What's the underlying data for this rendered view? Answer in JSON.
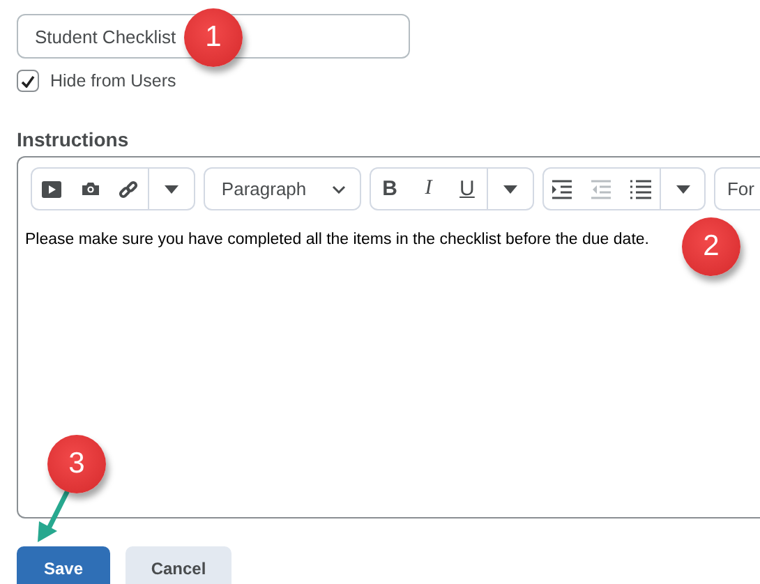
{
  "name_field": {
    "value": "Student Checklist"
  },
  "hide_from_users": {
    "label": "Hide from Users",
    "checked": true
  },
  "instructions": {
    "label": "Instructions",
    "toolbar": {
      "format_select": "Paragraph",
      "style_buttons": [
        "B",
        "I",
        "U"
      ],
      "list_buttons": [
        {
          "kind": "indent",
          "disabled": false
        },
        {
          "kind": "outdent",
          "disabled": true
        },
        {
          "kind": "bullets",
          "disabled": false
        }
      ],
      "font_button": "For"
    },
    "body": "Please make sure you have completed all the items in the checklist before the due date."
  },
  "buttons": [
    {
      "label": "Save",
      "kind": "primary"
    },
    {
      "label": "Cancel",
      "kind": "secondary"
    }
  ],
  "callouts": [
    {
      "number": "1"
    },
    {
      "number": "2"
    },
    {
      "number": "3"
    }
  ]
}
